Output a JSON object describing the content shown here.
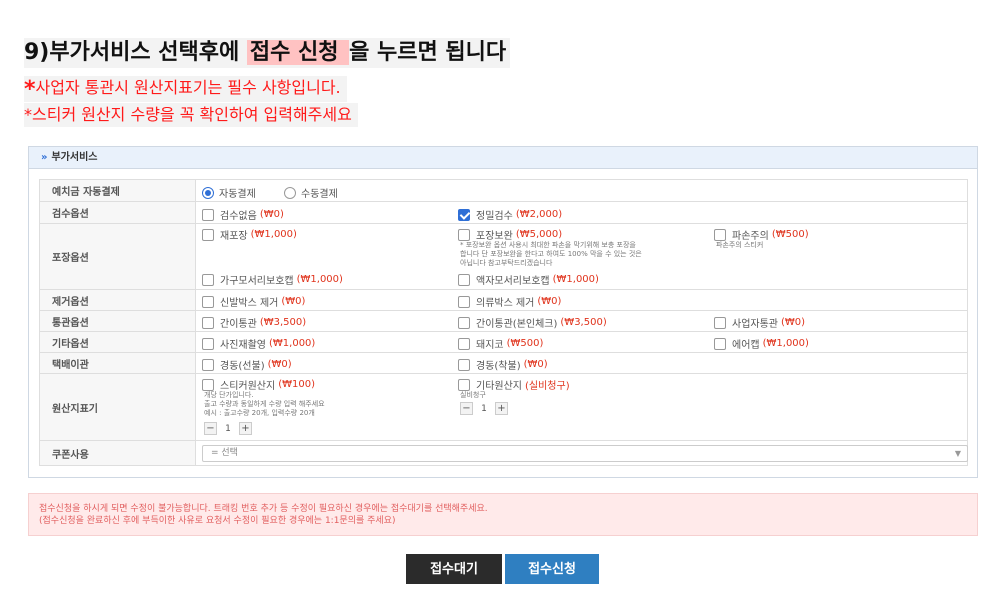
{
  "instructions": {
    "heading_pre": "9)부가서비스 선택후에 ",
    "heading_highlight": "접수 신청 ",
    "heading_post": "을 누르면 됩니다",
    "note1_star": "*",
    "note1_text": "사업자 통관시 원산지표기는 필수 사항입니다.",
    "note2_text": "*스티커 원산지 수량을 꼭 확인하여 입력해주세요"
  },
  "panel": {
    "chevron": "»",
    "title": "부가서비스"
  },
  "rows": {
    "prepaid": {
      "label": "예치금 자동결제",
      "options": [
        {
          "label": "자동결제",
          "selected": true
        },
        {
          "label": "수동결제",
          "selected": false
        }
      ]
    },
    "inspection": {
      "label": "검수옵션",
      "options": [
        {
          "label": "검수없음",
          "price": "(₩0)",
          "checked": false
        },
        {
          "label": "정밀검수",
          "price": "(₩2,000)",
          "checked": true
        }
      ]
    },
    "packaging": {
      "label": "포장옵션",
      "options": [
        {
          "label": "재포장",
          "price": "(₩1,000)",
          "checked": false
        },
        {
          "label": "포장보완",
          "price": "(₩5,000)",
          "checked": false
        },
        {
          "label": "파손주의",
          "price": "(₩500)",
          "checked": false
        },
        {
          "label": "가구모서리보호캡",
          "price": "(₩1,000)",
          "checked": false
        },
        {
          "label": "액자모서리보호캡",
          "price": "(₩1,000)",
          "checked": false
        }
      ],
      "note_reinforce": [
        "* 포장보완 옵션 사용시 최대한 파손을 막기위해 보충 포장을",
        "합니다 단 포장보완을 한다고 하여도 100% 막을 수 있는 것은",
        "아닙니다 참고부탁드리겠습니다"
      ],
      "note_fragile": "파손주의 스티커"
    },
    "removal": {
      "label": "제거옵션",
      "options": [
        {
          "label": "신발박스 제거",
          "price": "(₩0)",
          "checked": false
        },
        {
          "label": "의류박스 제거",
          "price": "(₩0)",
          "checked": false
        }
      ]
    },
    "customs": {
      "label": "통관옵션",
      "options": [
        {
          "label": "간이통관",
          "price": "(₩3,500)",
          "checked": false
        },
        {
          "label": "간이통관(본인체크)",
          "price": "(₩3,500)",
          "checked": false
        },
        {
          "label": "사업자통관",
          "price": "(₩0)",
          "checked": false
        }
      ]
    },
    "other": {
      "label": "기타옵션",
      "options": [
        {
          "label": "사진재촬영",
          "price": "(₩1,000)",
          "checked": false
        },
        {
          "label": "돼지코",
          "price": "(₩500)",
          "checked": false
        },
        {
          "label": "에어캡",
          "price": "(₩1,000)",
          "checked": false
        }
      ]
    },
    "courier": {
      "label": "택배이관",
      "options": [
        {
          "label": "경동(선불)",
          "price": "(₩0)",
          "checked": false
        },
        {
          "label": "경동(착불)",
          "price": "(₩0)",
          "checked": false
        }
      ]
    },
    "origin": {
      "label": "원산지표기",
      "sticker": {
        "label": "스티커원산지",
        "price": "(₩100)",
        "checked": false,
        "notes": [
          "개당 단가입니다.",
          "출고 수량과 동일하게 수량 입력 해주세요",
          "예시 : 출고수량 20개, 입력수량 20개"
        ],
        "quantity": "1"
      },
      "other": {
        "label": "기타원산지",
        "price": "(실비청구)",
        "checked": false,
        "note": "실비청구",
        "quantity": "1"
      }
    },
    "coupon": {
      "label": "쿠폰사용",
      "selected": "= 선택",
      "arrow": "▼"
    }
  },
  "alert": {
    "line1": "접수신청을 하시게 되면 수정이 불가능합니다. 트래킹 번호 추가 등 수정이 필요하신 경우에는 접수대기를 선택해주세요.",
    "line2": "(접수신청을 완료하신 후에 부득이한 사유로 요청서 수정이 필요한 경우에는 1:1문의를 주세요)"
  },
  "buttons": {
    "wait": "접수대기",
    "apply": "접수신청"
  },
  "stepper": {
    "minus": "−",
    "plus": "+"
  }
}
